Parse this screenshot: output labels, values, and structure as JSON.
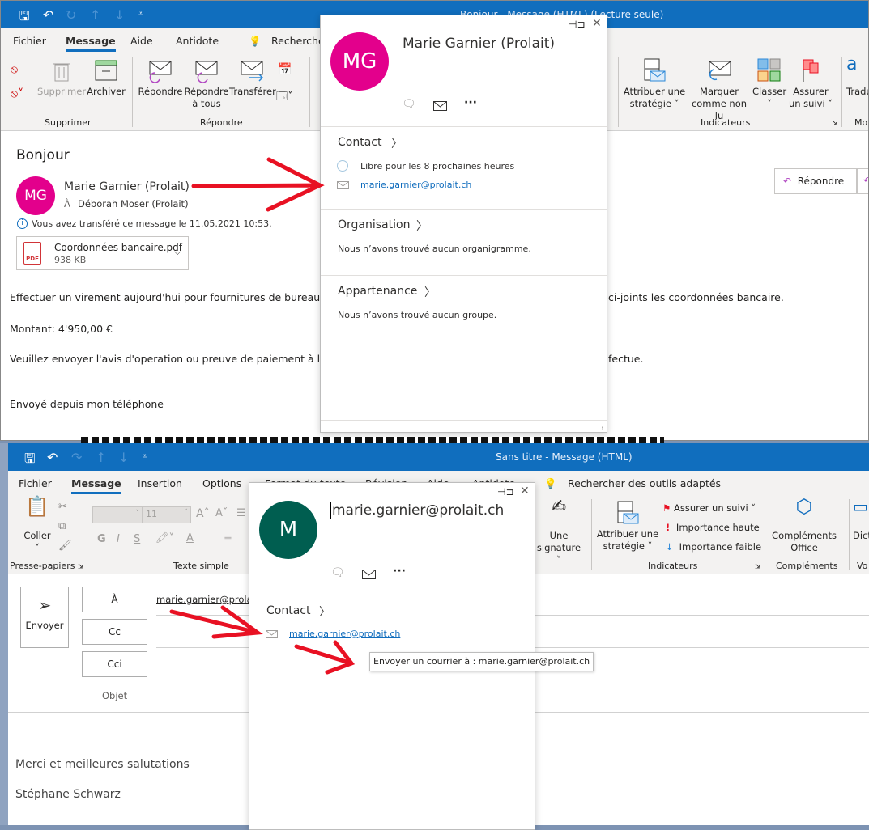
{
  "read_window": {
    "title": "Bonjour  -  Message (HTML) (Lecture seule)",
    "tabs": [
      "Fichier",
      "Message",
      "Aide",
      "Antidote"
    ],
    "active_tab": "Message",
    "search_label": "Recherche",
    "ribbon": {
      "delete_label": "Supprimer",
      "archive_label": "Archiver",
      "group_delete": "Supprimer",
      "reply_label": "Répondre",
      "reply_all_label": "Répondre à tous",
      "forward_label": "Transférer",
      "group_reply": "Répondre",
      "assign_policy_label": "Attribuer une stratégie ˅",
      "mark_unread_label": "Marquer comme non lu",
      "categorize_label": "Classer ˅",
      "follow_up_label": "Assurer un suivi ˅",
      "group_tags": "Indicateurs",
      "translate_label": "Tradu",
      "group_more": "Mo"
    },
    "message": {
      "subject": "Bonjour",
      "avatar_initials": "MG",
      "sender": "Marie Garnier (Prolait)",
      "to_label": "À",
      "recipient": "Déborah Moser (Prolait)",
      "info": "Vous avez transféré ce message le 11.05.2021 10:53.",
      "attachment_name": "Coordonnées bancaire.pdf",
      "attachment_size": "938 KB",
      "reply_button": "Répondre",
      "body_line1_left": "Effectuer un virement aujourd'hui pour fournitures de bureau, Ir",
      "body_line1_right": "ci-joints les coordonnées bancaire.",
      "body_amount": "Montant: 4'950,00 €",
      "body_line3_left": "Veuillez envoyer l'avis d'operation ou preuve de paiement à l'ad",
      "body_line3_right": "fectue.",
      "body_signature": "Envoyé depuis mon téléphone"
    },
    "contact_card": {
      "initials": "MG",
      "name": "Marie Garnier (Prolait)",
      "contact_heading": "Contact",
      "availability": "Libre pour les 8 prochaines heures",
      "email": "marie.garnier@prolait.ch",
      "org_heading": "Organisation",
      "org_empty": "Nous n’avons trouvé aucun organigramme.",
      "membership_heading": "Appartenance",
      "membership_empty": "Nous n’avons trouvé aucun groupe."
    }
  },
  "compose_window": {
    "title": "Sans titre  -  Message (HTML)",
    "tabs": [
      "Fichier",
      "Message",
      "Insertion",
      "Options",
      "Format du texte",
      "Révision",
      "Aide",
      "Antidote"
    ],
    "active_tab": "Message",
    "search_label": "Rechercher des outils adaptés",
    "ribbon": {
      "paste_label": "Coller",
      "group_clipboard": "Presse-papiers",
      "font_size": "11",
      "bold": "G",
      "italic": "I",
      "underline": "S",
      "group_text": "Texte simple",
      "signature_label": "Une signature ˅",
      "assign_policy_label": "Attribuer une stratégie ˅",
      "follow_up_label": "Assurer un suivi ˅",
      "high_importance_label": "Importance haute",
      "low_importance_label": "Importance faible",
      "group_tags": "Indicateurs",
      "addins_label": "Compléments Office",
      "group_addins": "Compléments",
      "dictate_label": "Dict",
      "group_voice": "Vo"
    },
    "send_label": "Envoyer",
    "to_button": "À",
    "cc_button": "Cc",
    "bcc_button": "Cci",
    "subject_label": "Objet",
    "to_value": "marie.garnier@prolait",
    "body_line1": "Merci et meilleures salutations",
    "body_line2": "Stéphane Schwarz",
    "contact_card": {
      "initials": "M",
      "name": "marie.garnier@prolait.ch",
      "contact_heading": "Contact",
      "email": "marie.garnier@prolait.ch"
    },
    "tooltip": "Envoyer un courrier à : marie.garnier@prolait.ch"
  },
  "colors": {
    "brand_blue": "#106ebe",
    "avatar_pink": "#e3008c",
    "avatar_green": "#005e50",
    "annotation_red": "#e81123"
  }
}
